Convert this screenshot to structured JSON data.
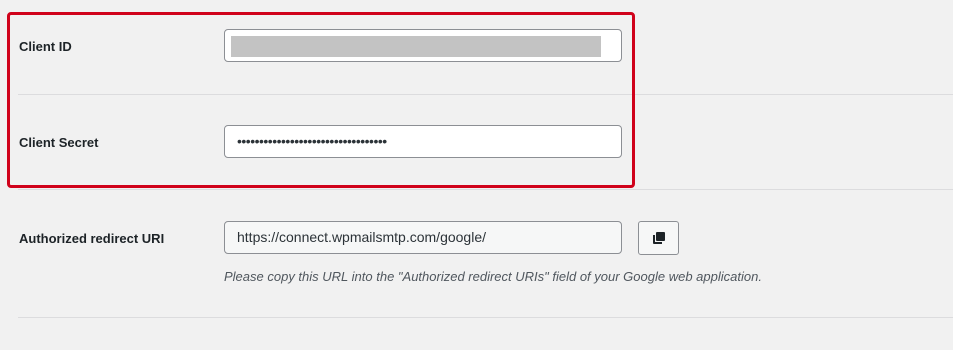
{
  "client_id": {
    "label": "Client ID",
    "value": ""
  },
  "client_secret": {
    "label": "Client Secret",
    "value": "••••••••••••••••••••••••••••••••••"
  },
  "redirect_uri": {
    "label": "Authorized redirect URI",
    "value": "https://connect.wpmailsmtp.com/google/",
    "help": "Please copy this URL into the \"Authorized redirect URIs\" field of your Google web application."
  },
  "copy_button": {
    "icon": "copy-icon"
  },
  "colors": {
    "background": "#f1f1f1",
    "highlight": "#d0021b",
    "input_border": "#8c8f94",
    "label_text": "#1d2327",
    "help_text": "#50575e"
  }
}
